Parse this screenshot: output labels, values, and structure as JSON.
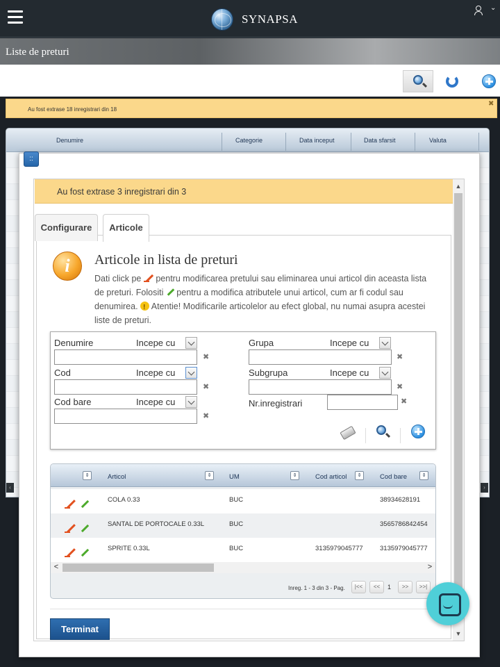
{
  "app": {
    "brand": "SYNAPSA"
  },
  "page": {
    "title": "Liste de preturi"
  },
  "toolbar": {
    "icons": [
      "search-icon",
      "refresh-icon",
      "add-icon"
    ]
  },
  "outer_info": {
    "message": "Au fost extrase 18 inregistrari din 18",
    "close_symbol": "✖"
  },
  "background_grid": {
    "columns": [
      "Denumire",
      "Categorie",
      "Data inceput",
      "Data sfarsit",
      "Valuta"
    ]
  },
  "modal": {
    "drag_symbol": "::",
    "info_message": "Au fost extrase 3 inregistrari din 3",
    "tabs": [
      {
        "label": "Configurare",
        "active": false
      },
      {
        "label": "Articole",
        "active": true
      }
    ],
    "heading": "Articole in lista de preturi",
    "desc": {
      "p1": "Dati click pe ",
      "p2": " pentru modificarea pretului sau eliminarea unui articol din aceasta lista de preturi. Folositi ",
      "p3": " pentru a modifica atributele unui articol, cum ar fi codul sau denumirea. ",
      "p4": " Atentie! Modificarile articolelor au efect global, nu numai asupra acestei liste de preturi."
    },
    "filters": {
      "denumire": {
        "label": "Denumire",
        "mode": "Incepe cu",
        "value": ""
      },
      "cod": {
        "label": "Cod",
        "mode": "Incepe cu",
        "value": ""
      },
      "cod_bare": {
        "label": "Cod bare",
        "mode": "Incepe cu",
        "value": ""
      },
      "grupa": {
        "label": "Grupa",
        "mode": "Incepe cu",
        "value": ""
      },
      "subgrupa": {
        "label": "Subgrupa",
        "mode": "Incepe cu",
        "value": ""
      },
      "nr_inregistrari": {
        "label": "Nr.inregistrari",
        "value": ""
      },
      "clear_symbol": "✖"
    },
    "grid": {
      "columns": [
        "Articol",
        "UM",
        "Cod articol",
        "Cod bare"
      ],
      "sort_symbol": "⇕",
      "rows": [
        {
          "articol": "COLA 0.33",
          "um": "BUC",
          "cod_articol": "",
          "cod_bare": "38934628191"
        },
        {
          "articol": "SANTAL DE PORTOCALE 0.33L",
          "um": "BUC",
          "cod_articol": "",
          "cod_bare": "3565786842454"
        },
        {
          "articol": "SPRITE 0.33L",
          "um": "BUC",
          "cod_articol": "3135979045777",
          "cod_bare": "3135979045777"
        }
      ],
      "pager": {
        "summary": "Inreg. 1 - 3 din 3 - Pag.",
        "current_page": "1",
        "first": "|<<",
        "prev": "<<",
        "next": ">>",
        "last": ">>|"
      }
    },
    "done_button": "Terminat"
  },
  "colors": {
    "topbar": "#232a30",
    "info_bar": "#fbd88b",
    "primary_button": "#1c528d",
    "chat": "#4fcfd8"
  }
}
